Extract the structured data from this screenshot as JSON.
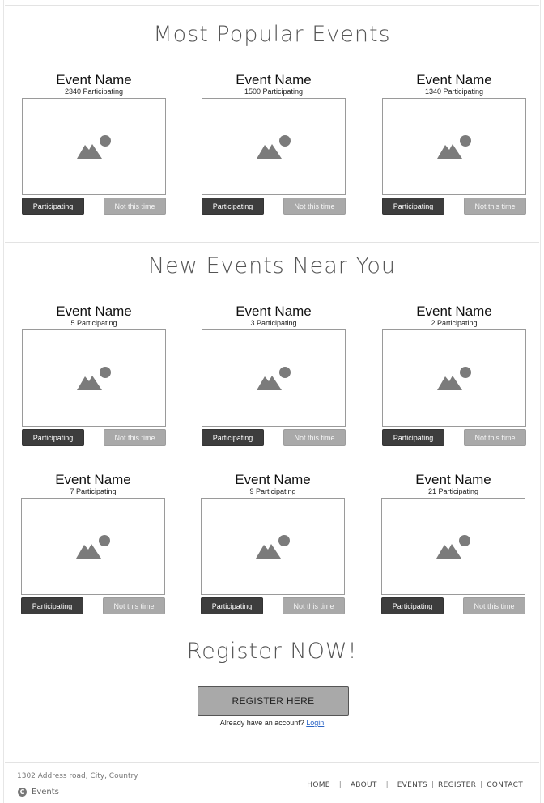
{
  "sections": {
    "popular_title": "Most Popular Events",
    "near_title": "New Events Near You",
    "register_title": "Register NOW!"
  },
  "buttons": {
    "participating": "Participating",
    "not_this_time": "Not this time"
  },
  "popular_events": [
    {
      "name": "Event Name",
      "count": "2340 Participating"
    },
    {
      "name": "Event Name",
      "count": "1500 Participating"
    },
    {
      "name": "Event Name",
      "count": "1340 Participating"
    }
  ],
  "near_events": [
    {
      "name": "Event Name",
      "count": "5 Participating"
    },
    {
      "name": "Event Name",
      "count": "3 Participating"
    },
    {
      "name": "Event Name",
      "count": "2 Participating"
    },
    {
      "name": "Event Name",
      "count": "7 Participating"
    },
    {
      "name": "Event Name",
      "count": "9 Participating"
    },
    {
      "name": "Event Name",
      "count": "21 Participating"
    }
  ],
  "register": {
    "button": "REGISTER HERE",
    "account_text": "Already have an account?",
    "login_link": "Login"
  },
  "footer": {
    "address": "1302 Address road, City, Country",
    "brand": "Events",
    "brand_icon": "copyright-icon",
    "nav": [
      "HOME",
      "ABOUT",
      "EVENTS",
      "REGISTER",
      "CONTACT"
    ]
  },
  "colors": {
    "primary_button": "#3d3d3d",
    "secondary_button": "#a9a9a9",
    "link": "#2a64c5"
  }
}
